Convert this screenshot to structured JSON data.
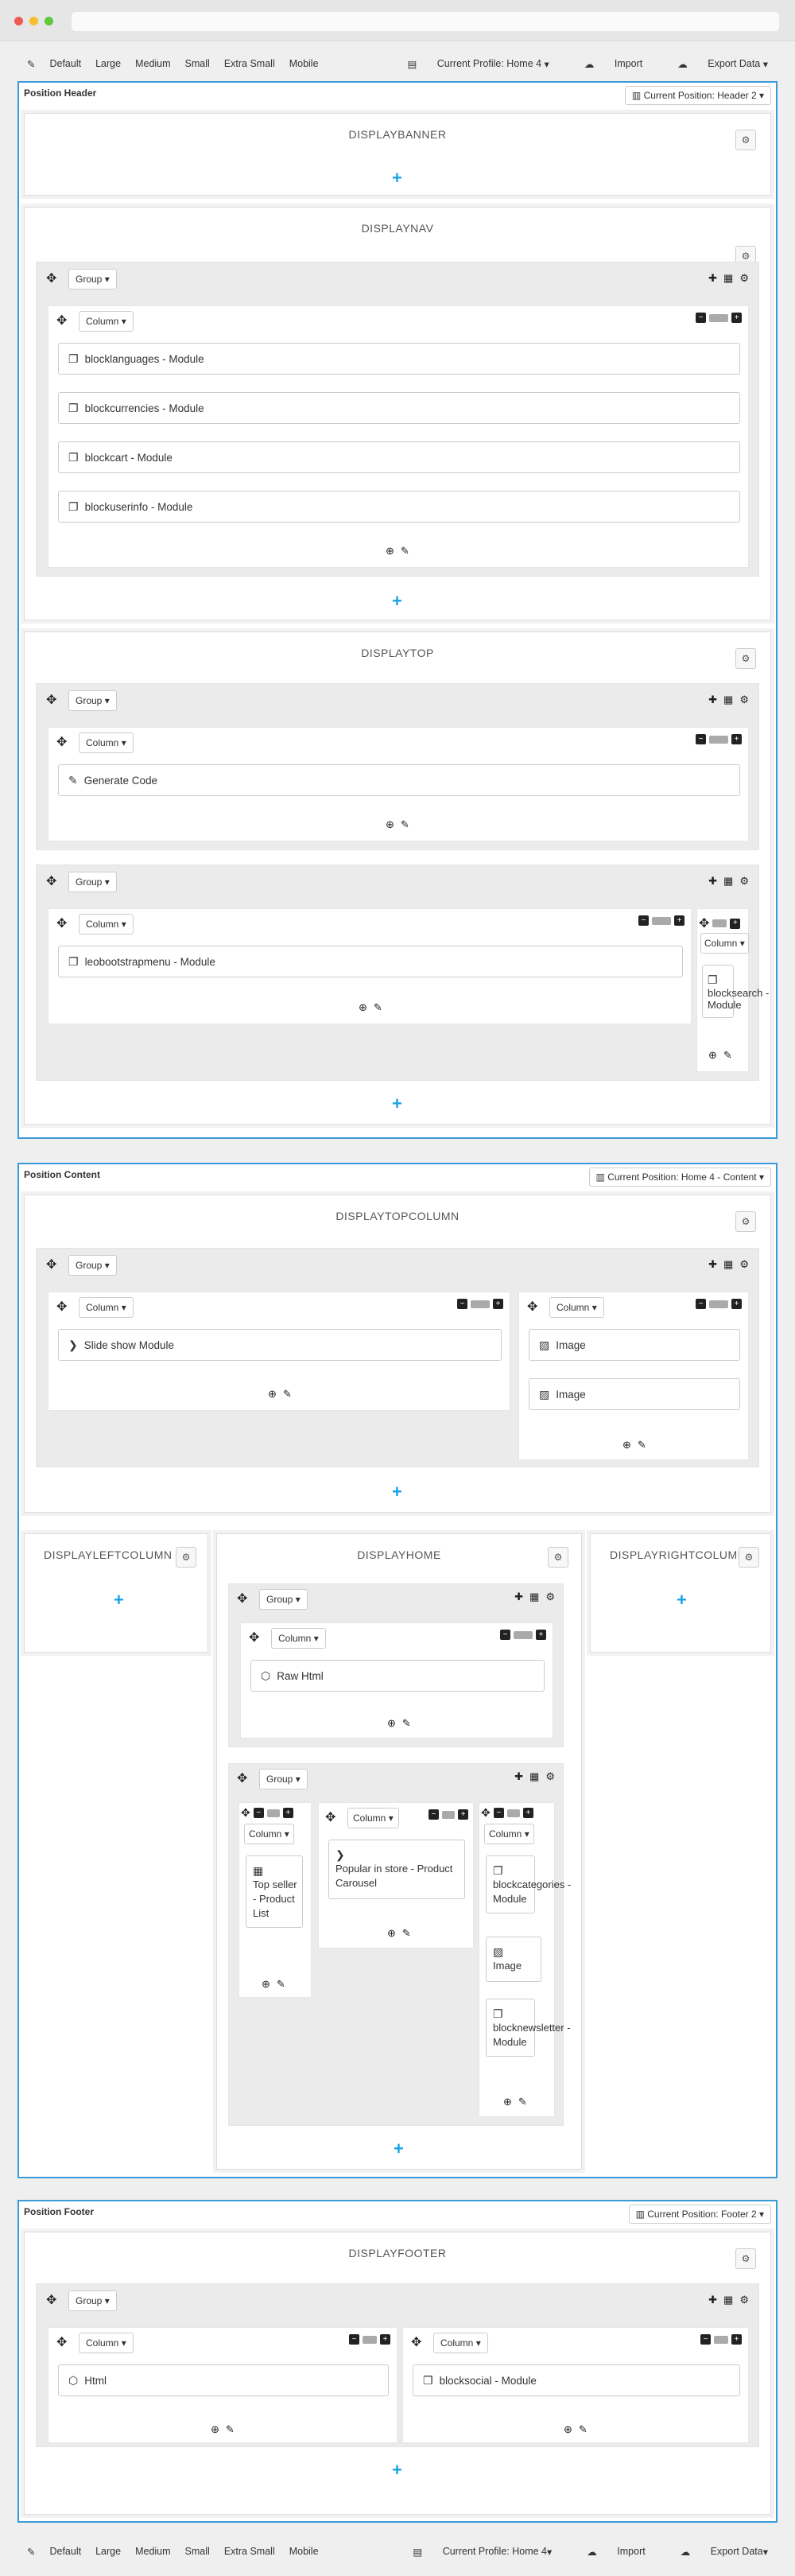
{
  "toolbar": {
    "wand": "✎",
    "sizes": [
      "Default",
      "Large",
      "Medium",
      "Small",
      "Extra Small",
      "Mobile"
    ],
    "profile": "Current Profile: Home 4",
    "import": "Import",
    "export": "Export Data"
  },
  "header": {
    "title": "Position Header",
    "current": "Current Position: Header 2",
    "banner": "DISPLAYBANNER",
    "nav": "DISPLAYNAV",
    "top": "DISPLAYTOP",
    "nav_modules": [
      "blocklanguages - Module",
      "blockcurrencies - Module",
      "blockcart - Module",
      "blockuserinfo - Module"
    ],
    "top_module1": "Generate Code",
    "top_module2": "leobootstrapmenu - Module",
    "top_module3": "blocksearch - Module"
  },
  "content": {
    "title": "Position Content",
    "current": "Current Position: Home 4 - Content",
    "topcolumn": "DISPLAYTOPCOLUMN",
    "slideshow": "Slide show Module",
    "image": "Image",
    "left": "DISPLAYLEFTCOLUMN",
    "home": "DISPLAYHOME",
    "right": "DISPLAYRIGHTCOLUMN",
    "rawhtml": "Raw Html",
    "topseller": "Top seller - Product List",
    "popular": "Popular in store - Product Carousel",
    "blockcategories": "blockcategories - Module",
    "blocknewsletter": "blocknewsletter - Module"
  },
  "footer": {
    "title": "Position Footer",
    "current": "Current Position: Footer 2",
    "display": "DISPLAYFOOTER",
    "html": "Html",
    "blocksocial": "blocksocial - Module"
  },
  "labels": {
    "group": "Group",
    "column": "Column"
  }
}
